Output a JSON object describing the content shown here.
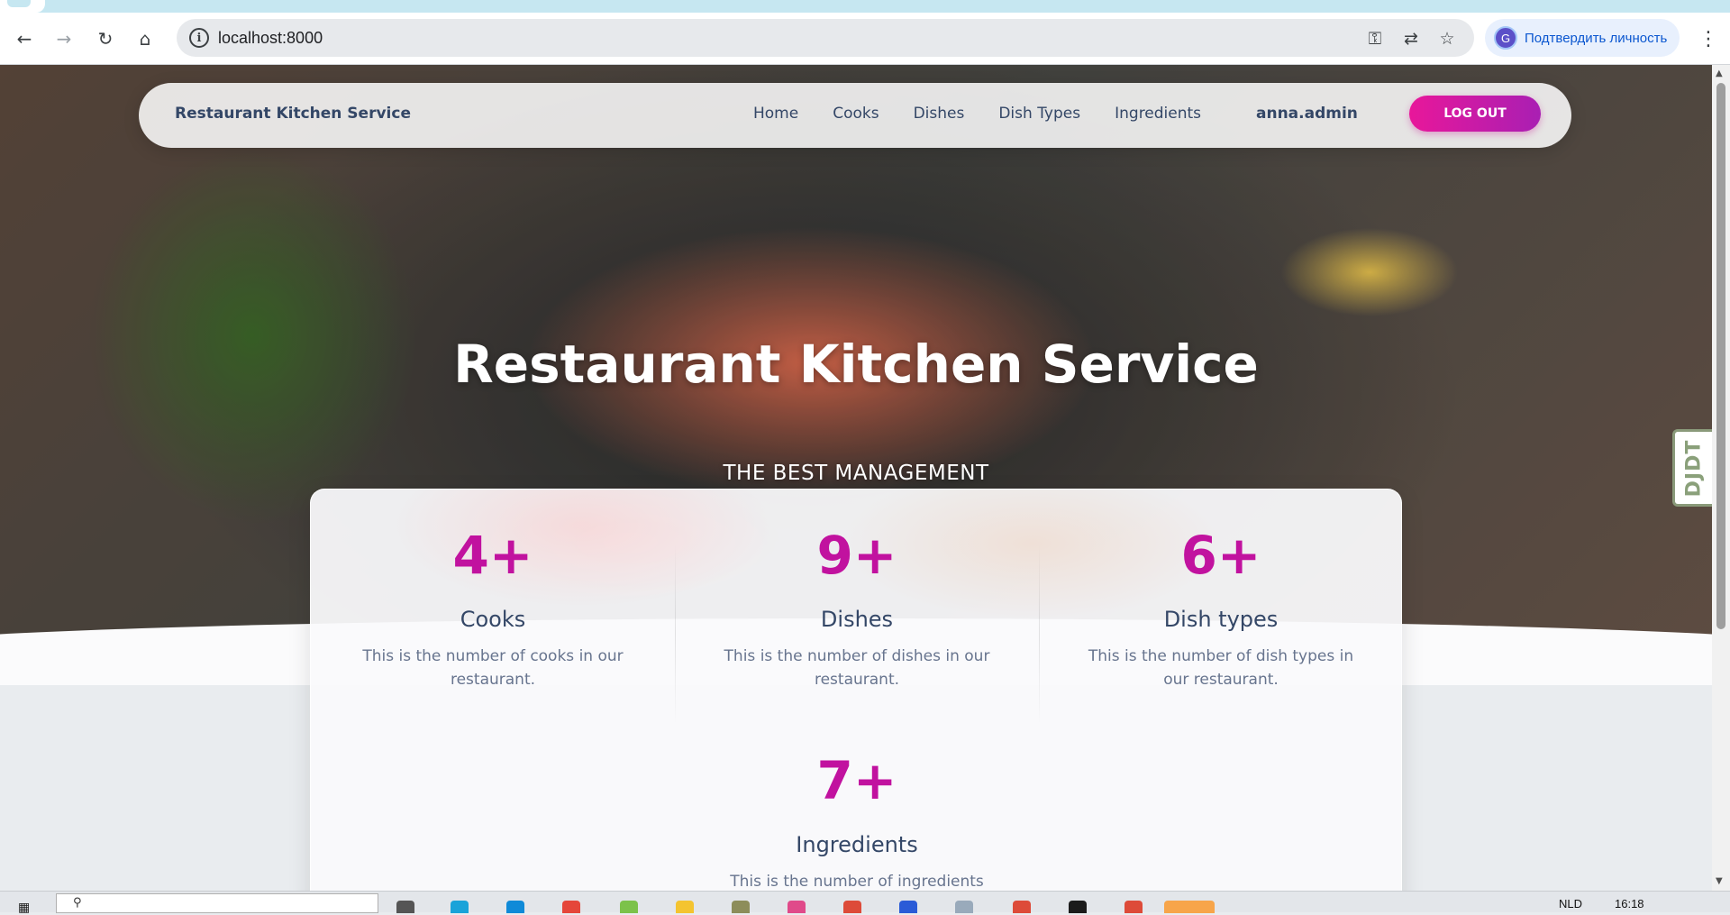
{
  "browser": {
    "url": "localhost:8000",
    "profile_initial": "G",
    "profile_label": "Подтвердить личность"
  },
  "navbar": {
    "brand": "Restaurant Kitchen Service",
    "links": [
      "Home",
      "Cooks",
      "Dishes",
      "Dish Types",
      "Ingredients"
    ],
    "user": "anna.admin",
    "logout_label": "LOG OUT"
  },
  "hero": {
    "title": "Restaurant Kitchen Service",
    "subtitle": "THE BEST MANAGEMENT"
  },
  "stats": [
    {
      "number": "4+",
      "title": "Cooks",
      "desc": "This is the number of cooks in our restaurant."
    },
    {
      "number": "9+",
      "title": "Dishes",
      "desc": "This is the number of dishes in our restaurant."
    },
    {
      "number": "6+",
      "title": "Dish types",
      "desc": "This is the number of dish types in our restaurant."
    },
    {
      "number": "7+",
      "title": "Ingredients",
      "desc": "This is the number of ingredients in our restaurant."
    }
  ],
  "djdt_label": "DJDT",
  "taskbar": {
    "lang": "NLD",
    "time": "16:18"
  },
  "colors": {
    "accent": "#c1129f",
    "text": "#344767",
    "muted": "#67748e",
    "logout_start": "#e8179a",
    "logout_end": "#a91fb3"
  }
}
